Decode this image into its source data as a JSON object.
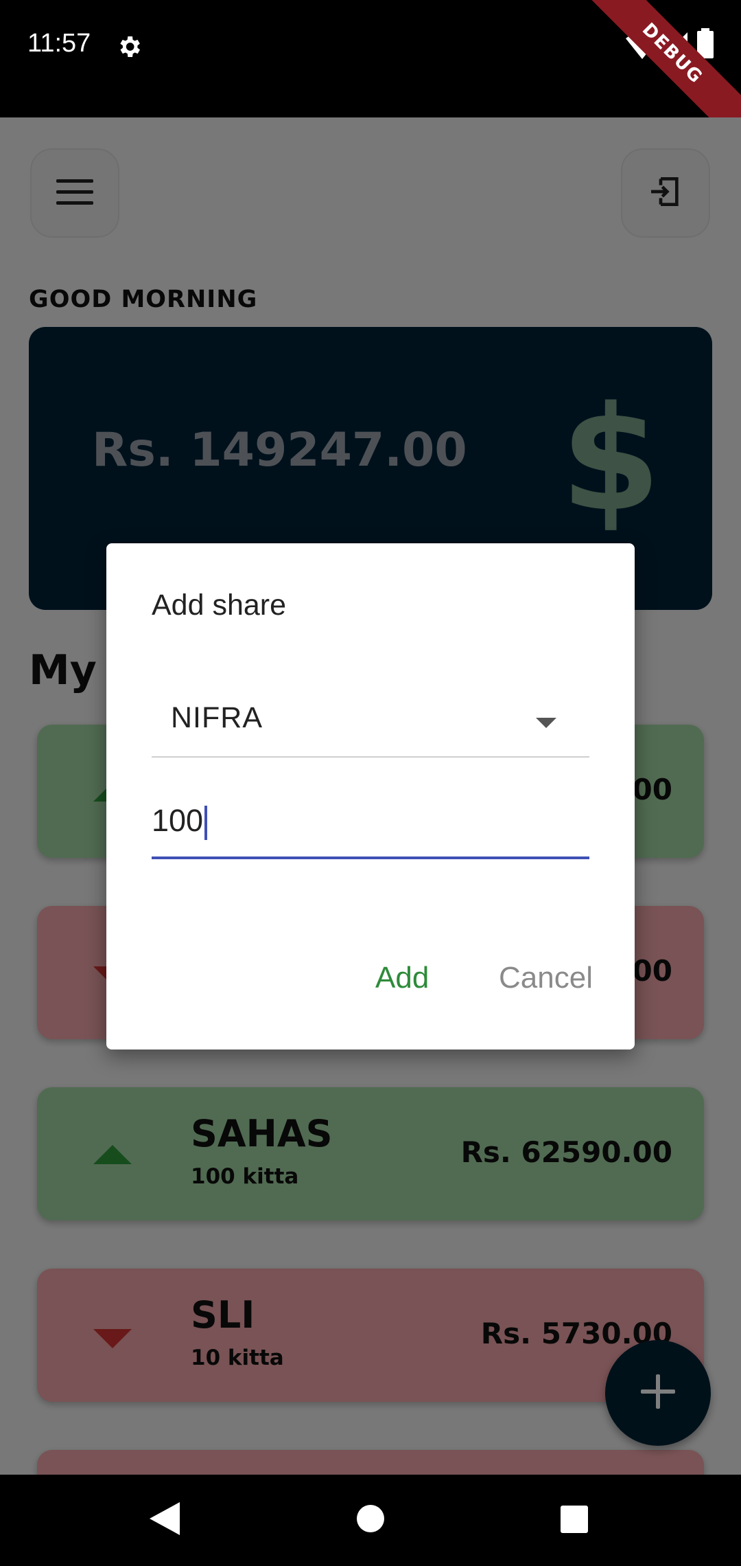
{
  "status_bar": {
    "time": "11:57",
    "debug_label": "DEBUG",
    "icons": [
      "settings-icon",
      "wifi-icon",
      "signal-icon",
      "battery-icon"
    ]
  },
  "header": {
    "menu_icon": "menu-icon",
    "logout_icon": "logout-icon",
    "greeting": "GOOD MORNING"
  },
  "balance": {
    "amount": "Rs. 149247.00",
    "symbol": "$"
  },
  "section": {
    "title": "My "
  },
  "shares": [
    {
      "name": "",
      "qty": "",
      "value": ".00",
      "trend": "up"
    },
    {
      "name": "",
      "qty": "",
      "value": ".00",
      "trend": "down"
    },
    {
      "name": "SAHAS",
      "qty": "100 kitta",
      "value": "Rs. 62590.00",
      "trend": "up"
    },
    {
      "name": "SLI",
      "qty": "10 kitta",
      "value": "Rs. 5730.00",
      "trend": "down"
    }
  ],
  "fab": {
    "icon": "plus-icon"
  },
  "dialog": {
    "title": "Add share",
    "dropdown_value": "NIFRA",
    "quantity_value": "100",
    "add_label": "Add",
    "cancel_label": "Cancel"
  },
  "colors": {
    "up_card": "#a3d7a4",
    "down_card": "#f3a6ab",
    "accent_blue": "#3f51b5",
    "add_green": "#2e8b3a",
    "card_navy": "#002338"
  }
}
